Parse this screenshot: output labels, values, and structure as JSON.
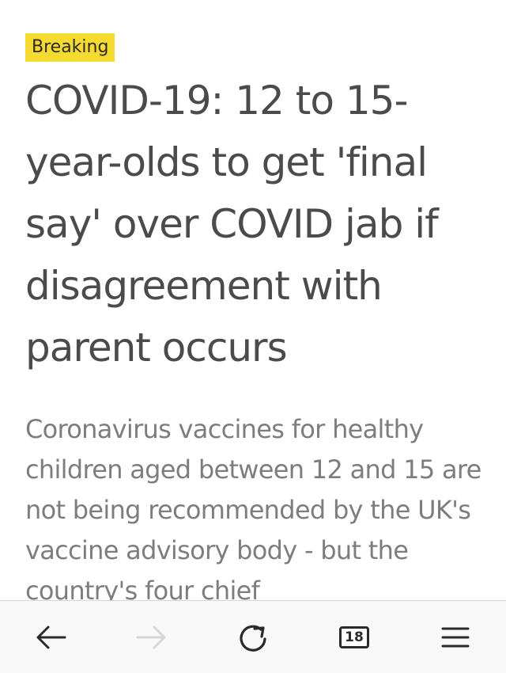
{
  "article": {
    "badge": "Breaking",
    "headline": "COVID-19: 12 to 15-year-olds to get 'final say' over COVID jab if disagreement with parent occurs",
    "summary": "Coronavirus vaccines for healthy children aged between 12 and 15 are not being recommended by the UK's vaccine advisory body - but the country's four chief"
  },
  "toolbar": {
    "tab_count": "18",
    "icons": {
      "back": "arrow-left-icon",
      "forward": "arrow-right-icon",
      "reload": "reload-icon",
      "tabs": "tabs-icon",
      "menu": "hamburger-menu-icon"
    }
  },
  "colors": {
    "badge_bg": "#f5da2f",
    "headline": "#4b4b4b",
    "summary": "#7d7d7d",
    "toolbar_bg": "#f8f8f8"
  }
}
